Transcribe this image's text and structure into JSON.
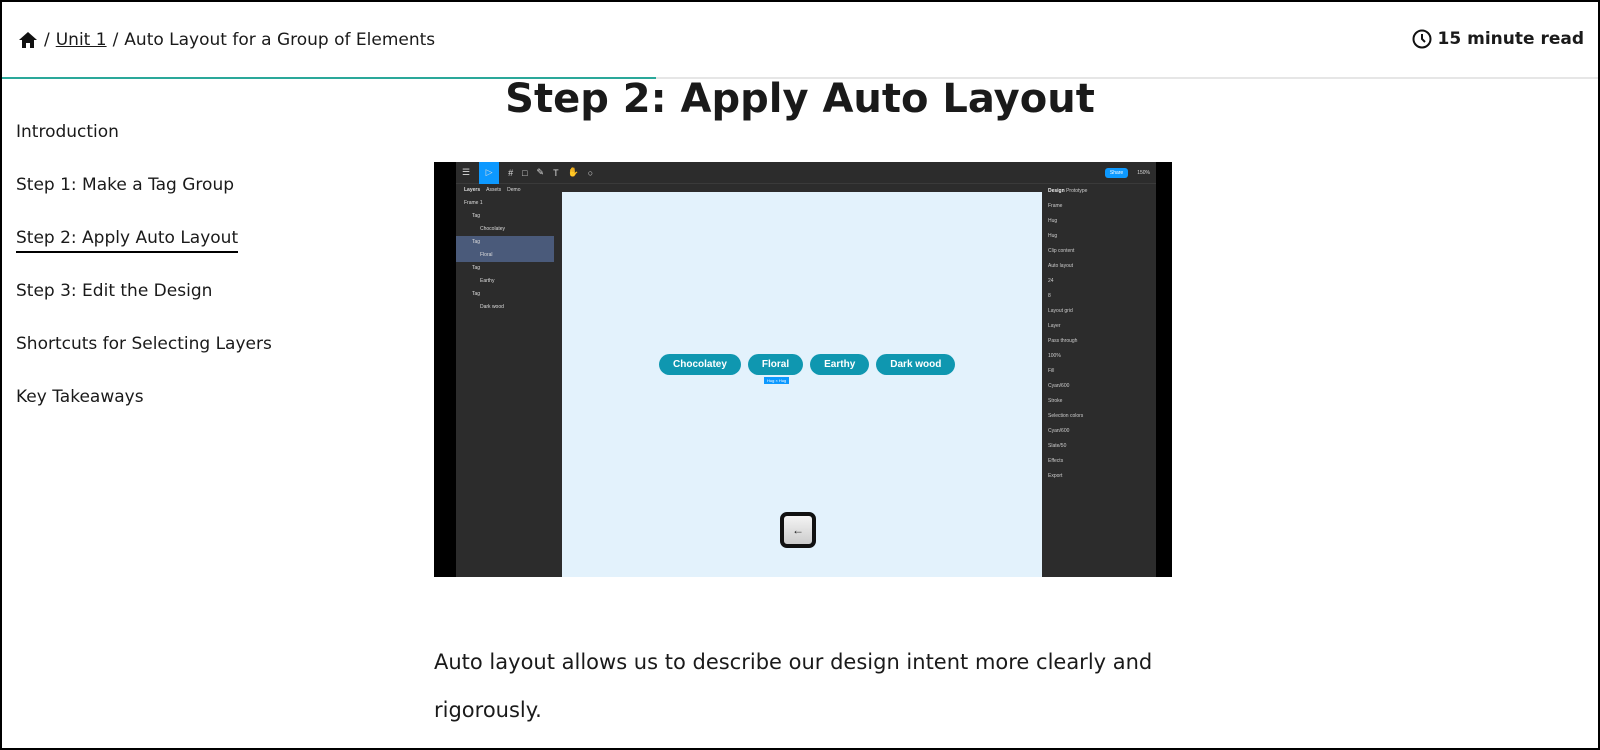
{
  "header": {
    "home_icon": "home-icon",
    "breadcrumb": [
      {
        "label": "Unit 1"
      },
      {
        "label": "Auto Layout for a Group of Elements"
      }
    ],
    "separator": "/",
    "read_time": "15 minute read",
    "clock_icon": "clock-icon",
    "progress_percent": 41,
    "accent": "#2aa89a"
  },
  "sidebar": {
    "items": [
      {
        "label": "Introduction"
      },
      {
        "label": "Step 1: Make a Tag Group"
      },
      {
        "label": "Step 2: Apply Auto Layout",
        "active": true
      },
      {
        "label": "Step 3: Edit the Design"
      },
      {
        "label": "Shortcuts for Selecting Layers"
      },
      {
        "label": "Key Takeaways"
      }
    ]
  },
  "main": {
    "title": "Step 2: Apply Auto Layout",
    "paragraph": "Auto layout allows us to describe our design intent more clearly and rigorously."
  },
  "video": {
    "layers_tabs": [
      "Layers",
      "Assets",
      "Demo"
    ],
    "layers": [
      "Frame 1",
      "Tag",
      "Chocolatey",
      "Tag",
      "Floral",
      "Tag",
      "Earthy",
      "Tag",
      "Dark wood"
    ],
    "share": "Share",
    "zoom": "150%",
    "panel_tabs": [
      "Design",
      "Prototype"
    ],
    "props": [
      "Frame",
      "Hug",
      "Hug",
      "Clip content",
      "Auto layout",
      "24",
      "8",
      "Layout grid",
      "Layer",
      "Pass through",
      "100%",
      "Fill",
      "Cyan/600",
      "Stroke",
      "Selection colors",
      "Cyan/600",
      "Slate/50",
      "Effects",
      "Export"
    ],
    "tags": [
      "Chocolatey",
      "Floral",
      "Earthy",
      "Dark wood"
    ],
    "tag_color": "#0f97b0",
    "hug_label": "Hug × Hug",
    "key_label": "←"
  }
}
